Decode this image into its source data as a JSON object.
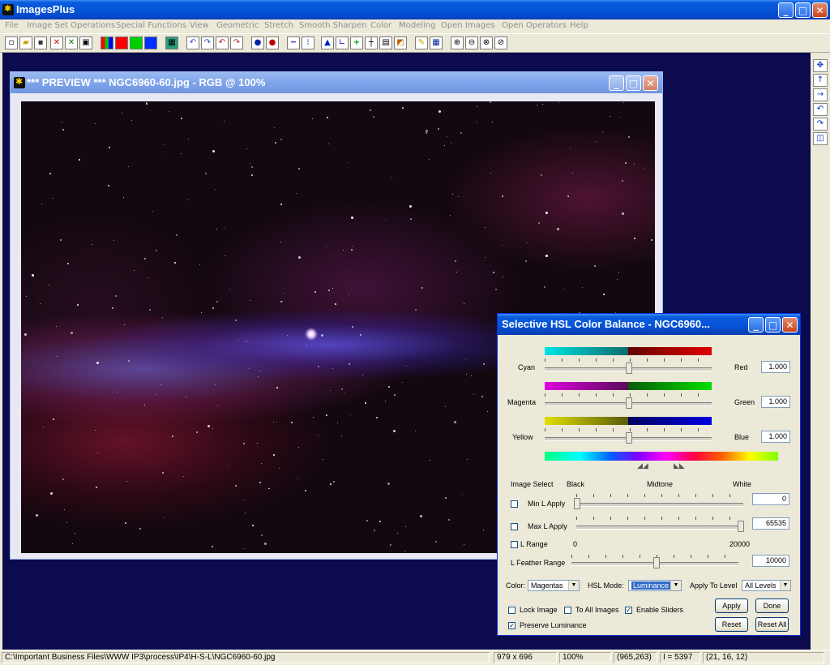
{
  "app": {
    "title": "ImagesPlus"
  },
  "menu": [
    "File",
    "Image Set Operations",
    "Special Functions",
    "View",
    "Geometric",
    "Stretch",
    "Smooth Sharpen",
    "Color",
    "Modeling",
    "Open Images",
    "Open Operators",
    "Help"
  ],
  "preview": {
    "title": "*** PREVIEW *** NGC6960-60.jpg - RGB @  100%"
  },
  "dialog": {
    "title": "Selective HSL Color Balance - NGC6960...",
    "balance": [
      {
        "left": "Cyan",
        "right": "Red",
        "value": "1.000"
      },
      {
        "left": "Magenta",
        "right": "Green",
        "value": "1.000"
      },
      {
        "left": "Yellow",
        "right": "Blue",
        "value": "1.000"
      }
    ],
    "image_select_label": "Image Select",
    "black_label": "Black",
    "midtone_label": "Midtone",
    "white_label": "White",
    "min_l_label": "Min L Apply",
    "min_l_value": "0",
    "max_l_label": "Max L Apply",
    "max_l_value": "65535",
    "l_range_label": "L Range",
    "l_range_min": "0",
    "l_range_max": "20000",
    "feather_label": "L Feather Range",
    "feather_value": "10000",
    "color_label": "Color:",
    "color_value": "Magentas",
    "hsl_mode_label": "HSL Mode:",
    "hsl_mode_value": "Luminance",
    "apply_level_label": "Apply To Level",
    "apply_level_value": "All Levels",
    "lock_image_label": "Lock Image",
    "to_all_images_label": "To All Images",
    "enable_sliders_label": "Enable Sliders",
    "preserve_luminance_label": "Preserve Luminance",
    "apply_button": "Apply",
    "done_button": "Done",
    "reset_button": "Reset",
    "reset_all_button": "Reset All",
    "checks": {
      "min_l": false,
      "max_l": false,
      "l_range": false,
      "lock_image": false,
      "to_all_images": false,
      "enable_sliders": true,
      "preserve_luminance": true
    }
  },
  "status": {
    "path": "C:\\Important Business Files\\WWW IP3\\process\\IP4\\H-S-L\\NGC6960-60.jpg",
    "dimensions": "979 x 696",
    "zoom": "100%",
    "coords": "(965,263)",
    "intensity": "I = 5397",
    "rgb": "(21, 16, 12)"
  }
}
